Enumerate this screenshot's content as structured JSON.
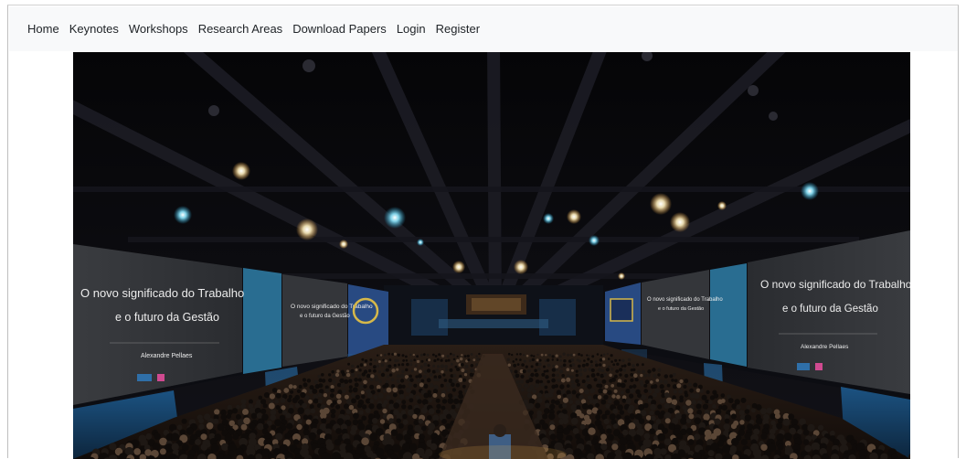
{
  "nav": {
    "items": [
      {
        "label": "Home",
        "name": "nav-home"
      },
      {
        "label": "Keynotes",
        "name": "nav-keynotes"
      },
      {
        "label": "Workshops",
        "name": "nav-workshops"
      },
      {
        "label": "Research Areas",
        "name": "nav-research-areas"
      },
      {
        "label": "Download Papers",
        "name": "nav-download-papers"
      },
      {
        "label": "Login",
        "name": "nav-login"
      },
      {
        "label": "Register",
        "name": "nav-register"
      }
    ]
  },
  "hero": {
    "left_screen": {
      "line1": "O novo significado do Trabalho",
      "line2": "e o futuro da Gestão",
      "speaker": "Alexandre Pellaes"
    },
    "right_screen": {
      "line1": "O novo significado do Trabalho",
      "line2": "e o futuro da Gestão",
      "speaker": "Alexandre Pellaes"
    },
    "colors": {
      "ceiling": "#0b0b10",
      "screen": "#2e3034",
      "stage_blue": "#2a6fb0",
      "audience": "#1a1512",
      "light": "#fff2c8"
    }
  }
}
